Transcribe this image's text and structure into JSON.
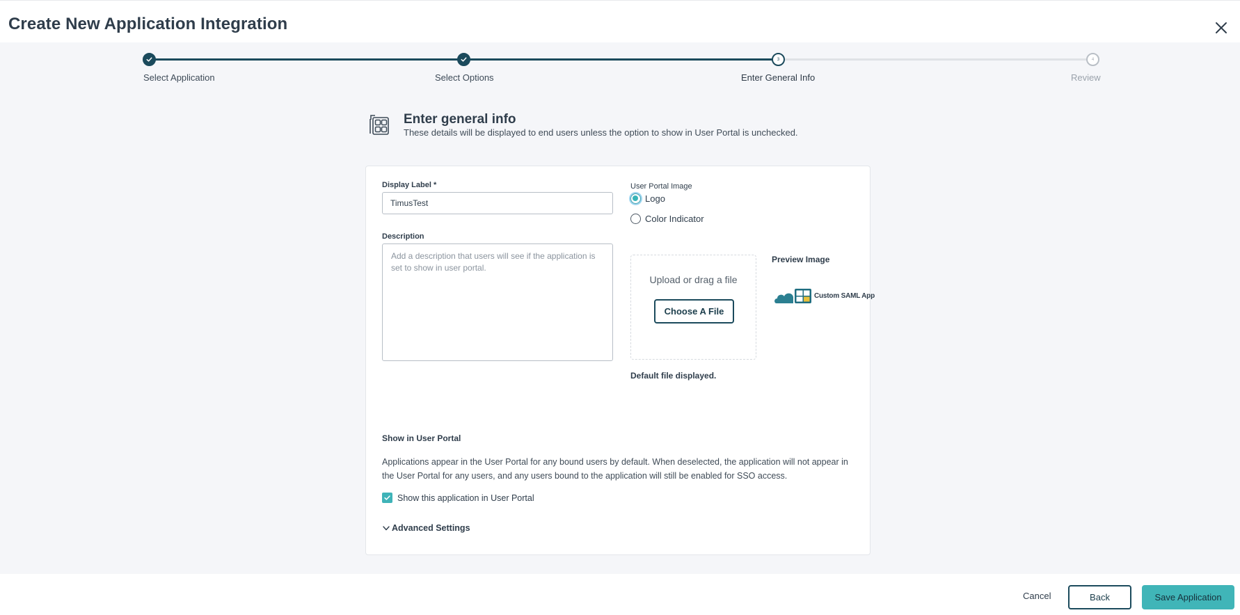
{
  "header": {
    "title": "Create New Application Integration",
    "close_icon": "close-icon"
  },
  "stepper": {
    "steps": [
      {
        "label": "Select Application",
        "state": "done"
      },
      {
        "label": "Select Options",
        "state": "done"
      },
      {
        "label": "Enter General Info",
        "state": "current",
        "number": "3"
      },
      {
        "label": "Review",
        "state": "todo",
        "number": "4"
      }
    ]
  },
  "section": {
    "icon": "apps-grid-icon",
    "title": "Enter general info",
    "subtitle": "These details will be displayed to end users unless the option to show in User Portal is unchecked."
  },
  "form": {
    "display_label_label": "Display Label *",
    "display_label_value": "TimusTest",
    "description_label": "Description",
    "description_placeholder": "Add a description that users will see if the application is set to show in user portal.",
    "user_portal_image_label": "User Portal Image",
    "image_options": [
      {
        "label": "Logo",
        "selected": true
      },
      {
        "label": "Color Indicator",
        "selected": false
      }
    ],
    "upload_text": "Upload or drag a file",
    "choose_file_label": "Choose A File",
    "default_note": "Default file displayed.",
    "preview_title": "Preview Image",
    "preview_logo_text": "Custom SAML App",
    "preview_logo_colors": {
      "cloud": "#2b7f91",
      "grid": "#1f6d80",
      "accent": "#e8c03a"
    }
  },
  "portal": {
    "title": "Show in User Portal",
    "description": "Applications appear in the User Portal for any bound users by default. When deselected, the application will not appear in the User Portal for any users, and any users bound to the application will still be enabled for SSO access.",
    "checkbox_label": "Show this application in User Portal",
    "checkbox_checked": true,
    "advanced_label": "Advanced Settings"
  },
  "footer": {
    "cancel_label": "Cancel",
    "back_label": "Back",
    "save_label": "Save Application"
  },
  "colors": {
    "primary_dark": "#1b4a5c",
    "accent_teal": "#40b5b8",
    "background": "#f5f6f9"
  }
}
